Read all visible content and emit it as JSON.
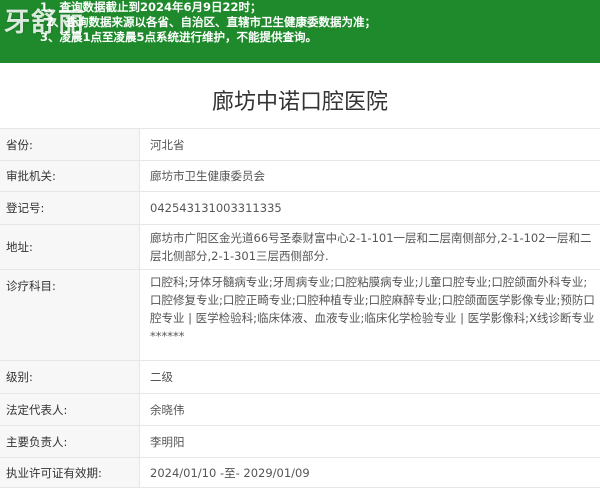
{
  "banner": {
    "logo_text": "牙舒丽",
    "notices": [
      "1、查询数据截止到2024年6月9日22时；",
      "2、查询数据来源以各省、自治区、直辖市卫生健康委数据为准；",
      "3、凌晨1点至凌晨5点系统进行维护，不能提供查询。"
    ]
  },
  "title": "廊坊中诺口腔医院",
  "rows": [
    {
      "label": "省份:",
      "value": "河北省"
    },
    {
      "label": "审批机关:",
      "value": "廊坊市卫生健康委员会"
    },
    {
      "label": "登记号:",
      "value": "042543131003311335"
    },
    {
      "label": "地址:",
      "value": "廊坊市广阳区金光道66号圣泰财富中心2-1-101一层和二层南侧部分,2-1-102一层和二层北侧部分,2-1-301三层西侧部分."
    },
    {
      "label": "诊疗科目:",
      "value": "口腔科;牙体牙髓病专业;牙周病专业;口腔粘膜病专业;儿童口腔专业;口腔颌面外科专业;口腔修复专业;口腔正畸专业;口腔种植专业;口腔麻醉专业;口腔颌面医学影像专业;预防口腔专业 | 医学检验科;临床体液、血液专业;临床化学检验专业 | 医学影像科;X线诊断专业******"
    },
    {
      "label": "级别:",
      "value": "二级"
    },
    {
      "label": "法定代表人:",
      "value": "余晓伟"
    },
    {
      "label": "主要负责人:",
      "value": "李明阳"
    },
    {
      "label": "执业许可证有效期:",
      "value": "2024/01/10 -至- 2029/01/09"
    }
  ]
}
